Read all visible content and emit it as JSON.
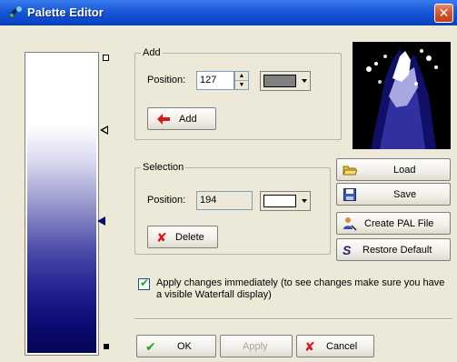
{
  "window": {
    "title": "Palette Editor",
    "close_glyph": "✕"
  },
  "add_group": {
    "legend": "Add",
    "position_label": "Position:",
    "position_value": "127",
    "color": "#808080",
    "add_label": "Add",
    "add_icon": "left-arrow-red-icon"
  },
  "selection_group": {
    "legend": "Selection",
    "position_label": "Position:",
    "position_value": "194",
    "color": "#ffffff",
    "delete_label": "Delete",
    "delete_icon": "red-x-icon"
  },
  "side_buttons": {
    "load_label": "Load",
    "save_label": "Save",
    "create_pal_label": "Create PAL File",
    "restore_label": "Restore Default"
  },
  "apply_option": {
    "checked": true,
    "text": "Apply changes immediately (to see changes make sure you have a visible Waterfall display)"
  },
  "footer": {
    "ok_label": "OK",
    "apply_label": "Apply",
    "cancel_label": "Cancel"
  },
  "colors": {
    "titlebar": "#0a45c8",
    "palette_top": "#ffffff",
    "palette_bottom": "#050558",
    "accent_red": "#d61818",
    "accent_green": "#21a121"
  }
}
